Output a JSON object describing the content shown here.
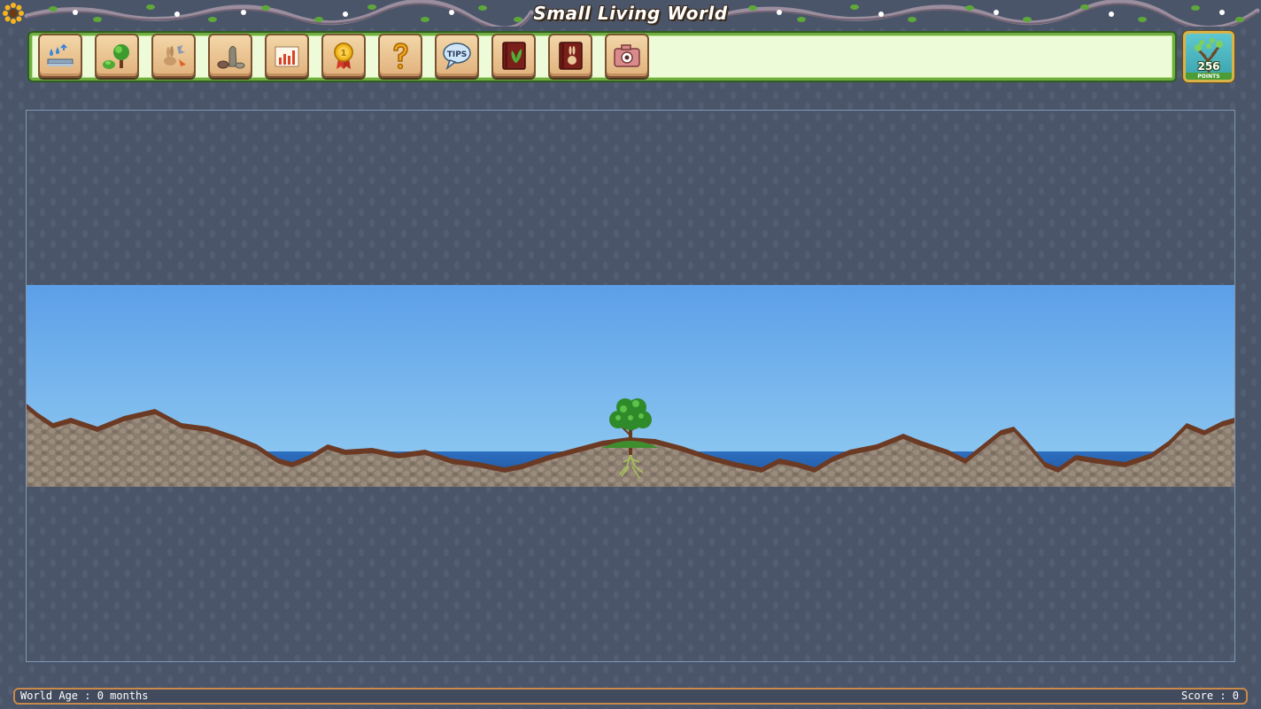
{
  "app": {
    "title": "Small Living World"
  },
  "toolbar": {
    "tools": [
      {
        "name": "water-tool",
        "icon": "water-drops-icon"
      },
      {
        "name": "plants-tool",
        "icon": "tree-bush-icon"
      },
      {
        "name": "animals-tool",
        "icon": "rabbit-bird-icon"
      },
      {
        "name": "rocks-tool",
        "icon": "rocks-icon"
      },
      {
        "name": "stats-tool",
        "icon": "chart-icon"
      },
      {
        "name": "achievements-tool",
        "icon": "medal-icon"
      },
      {
        "name": "help-tool",
        "icon": "question-mark-icon"
      },
      {
        "name": "tips-tool",
        "icon": "tips-bubble-icon"
      },
      {
        "name": "plant-book-tool",
        "icon": "plant-book-icon"
      },
      {
        "name": "animal-book-tool",
        "icon": "animal-book-icon"
      },
      {
        "name": "screenshot-tool",
        "icon": "camera-icon"
      }
    ],
    "medal_number": "1",
    "tips_label": "TIPS"
  },
  "points": {
    "value": "256",
    "label": "POINTS"
  },
  "colors": {
    "background": "#4a5569",
    "sky_top": "#5c9fe8",
    "sky_bottom": "#93cdf2",
    "water": "#2d6fc1",
    "rock": "#8a7c6e",
    "soil": "#6b3a24",
    "toolbar_bg": "#eefbd8",
    "toolbar_border": "#6fae3f",
    "status_border": "#c8894a"
  },
  "status": {
    "world_age": "World Age : 0 months",
    "score": "Score : 0"
  }
}
